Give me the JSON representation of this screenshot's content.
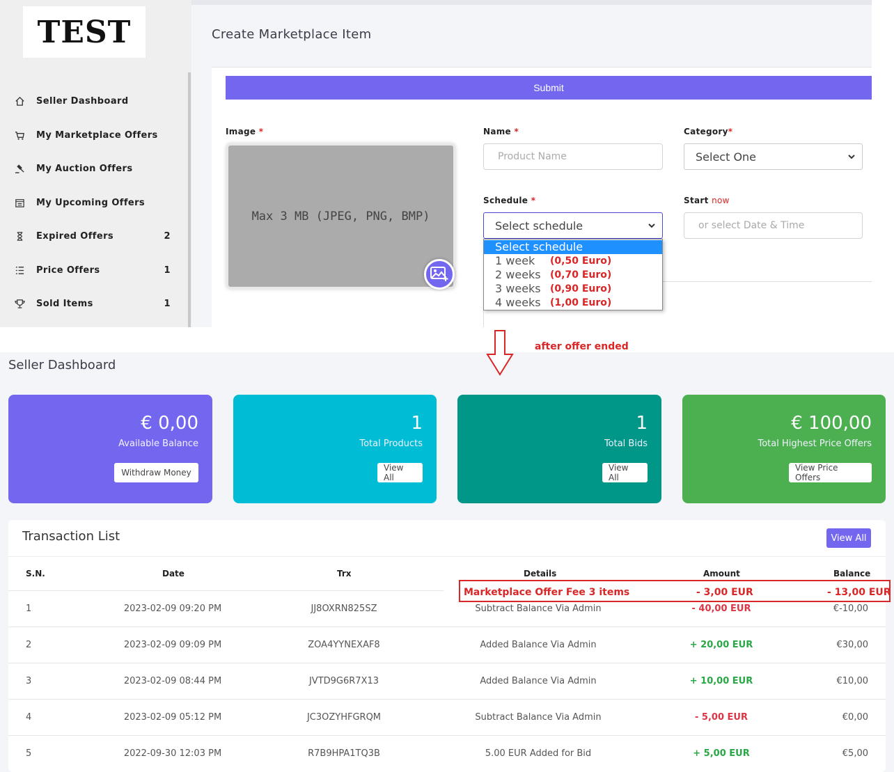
{
  "logo": "TEST",
  "sidebar": {
    "items": [
      {
        "label": "Seller Dashboard",
        "icon": "home-icon",
        "count": ""
      },
      {
        "label": "My Marketplace Offers",
        "icon": "cart-icon",
        "count": ""
      },
      {
        "label": "My Auction Offers",
        "icon": "gavel-icon",
        "count": ""
      },
      {
        "label": "My Upcoming Offers",
        "icon": "calendar-icon",
        "count": ""
      },
      {
        "label": "Expired Offers",
        "icon": "hourglass-icon",
        "count": "2"
      },
      {
        "label": "Price Offers",
        "icon": "list-icon",
        "count": "1"
      },
      {
        "label": "Sold Items",
        "icon": "trophy-icon",
        "count": "1"
      }
    ]
  },
  "create": {
    "title": "Create Marketplace Item",
    "submit": "Submit",
    "image_label": "Image",
    "image_placeholder": "Max 3 MB (JPEG, PNG, BMP)",
    "name_label": "Name",
    "name_placeholder": "Product Name",
    "category_label": "Category",
    "category_value": "Select One",
    "schedule_label": "Schedule",
    "schedule_value": "Select schedule",
    "start_label": "Start",
    "start_now": "now",
    "start_placeholder": "or select Date & Time",
    "required_mark": "*",
    "schedule_options": [
      {
        "label": "Select schedule",
        "price": ""
      },
      {
        "label": "1 week",
        "price": "(0,50 Euro)"
      },
      {
        "label": "2 weeks",
        "price": "(0,70 Euro)"
      },
      {
        "label": "3 weeks",
        "price": "(0,90 Euro)"
      },
      {
        "label": "4 weeks",
        "price": "(1,00 Euro)"
      }
    ]
  },
  "annotation": {
    "note": "after offer ended",
    "fee_details": "Marketplace Offer Fee 3 items",
    "fee_amount": "- 3,00 EUR",
    "fee_balance": "- 13,00 EUR"
  },
  "dashboard": {
    "title": "Seller Dashboard",
    "stats": [
      {
        "value": "€ 0,00",
        "label": "Available Balance",
        "button": "Withdraw Money",
        "color": "#7367f0"
      },
      {
        "value": "1",
        "label": "Total Products",
        "button": "View All",
        "color": "#00bcd4"
      },
      {
        "value": "1",
        "label": "Total Bids",
        "button": "View All",
        "color": "#009688"
      },
      {
        "value": "€ 100,00",
        "label": "Total Highest Price Offers",
        "button": "View Price Offers",
        "color": "#4caf50"
      }
    ]
  },
  "transactions": {
    "title": "Transaction List",
    "view_all": "View All",
    "headers": [
      "S.N.",
      "Date",
      "Trx",
      "Details",
      "Amount",
      "Balance"
    ],
    "rows": [
      {
        "sn": "1",
        "date": "2023-02-09 09:20 PM",
        "trx": "JJ8OXRN825SZ",
        "details": "Subtract Balance Via Admin",
        "amount": "- 40,00 EUR",
        "balance": "€-10,00"
      },
      {
        "sn": "2",
        "date": "2023-02-09 09:09 PM",
        "trx": "ZOA4YYNEXAF8",
        "details": "Added Balance Via Admin",
        "amount": "+ 20,00 EUR",
        "balance": "€30,00"
      },
      {
        "sn": "3",
        "date": "2023-02-09 08:44 PM",
        "trx": "JVTD9G6R7X13",
        "details": "Added Balance Via Admin",
        "amount": "+ 10,00 EUR",
        "balance": "€10,00"
      },
      {
        "sn": "4",
        "date": "2023-02-09 05:12 PM",
        "trx": "JC3OZYHFGRQM",
        "details": "Subtract Balance Via Admin",
        "amount": "- 5,00 EUR",
        "balance": "€0,00"
      },
      {
        "sn": "5",
        "date": "2022-09-30 12:03 PM",
        "trx": "R7B9HPA1TQ3B",
        "details": "5.00 EUR Added for Bid",
        "amount": "+ 5,00 EUR",
        "balance": "€5,00"
      }
    ]
  }
}
